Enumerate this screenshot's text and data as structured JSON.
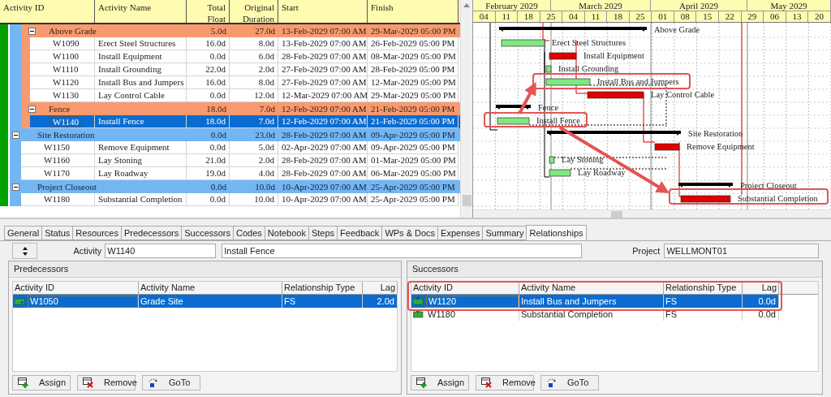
{
  "table": {
    "columns": [
      "Activity ID",
      "Activity Name",
      "Total Float",
      "Original Duration",
      "Start",
      "Finish"
    ],
    "rows": [
      {
        "kind": "subgroup",
        "name": "Above Grade",
        "expanded": true,
        "selected": false,
        "total_float": "5.0d",
        "original_duration": "27.0d",
        "start": "13-Feb-2029 07:00 AM",
        "finish": "29-Mar-2029 05:00 PM",
        "children": [
          {
            "id": "W1090",
            "name": "Erect Steel Structures",
            "selected": false,
            "total_float": "16.0d",
            "original_duration": "8.0d",
            "start": "13-Feb-2029 07:00 AM",
            "finish": "26-Feb-2029 05:00 PM"
          },
          {
            "id": "W1100",
            "name": "Install Equipment",
            "selected": false,
            "total_float": "0.0d",
            "original_duration": "6.0d",
            "start": "28-Feb-2029 07:00 AM",
            "finish": "08-Mar-2029 05:00 PM"
          },
          {
            "id": "W1110",
            "name": "Install Grounding",
            "selected": false,
            "total_float": "22.0d",
            "original_duration": "2.0d",
            "start": "27-Feb-2029 07:00 AM",
            "finish": "28-Feb-2029 05:00 PM"
          },
          {
            "id": "W1120",
            "name": "Install Bus and Jumpers",
            "selected": false,
            "total_float": "16.0d",
            "original_duration": "8.0d",
            "start": "27-Feb-2029 07:00 AM",
            "finish": "12-Mar-2029 05:00 PM"
          },
          {
            "id": "W1130",
            "name": "Lay Control Cable",
            "selected": false,
            "total_float": "0.0d",
            "original_duration": "12.0d",
            "start": "12-Mar-2029 07:00 AM",
            "finish": "29-Mar-2029 05:00 PM"
          }
        ]
      },
      {
        "kind": "subgroup",
        "name": "Fence",
        "expanded": true,
        "selected": false,
        "total_float": "18.0d",
        "original_duration": "7.0d",
        "start": "12-Feb-2029 07:00 AM",
        "finish": "21-Feb-2029 05:00 PM",
        "children": [
          {
            "id": "W1140",
            "name": "Install Fence",
            "selected": true,
            "total_float": "18.0d",
            "original_duration": "7.0d",
            "start": "12-Feb-2029 07:00 AM",
            "finish": "21-Feb-2029 05:00 PM"
          }
        ]
      },
      {
        "kind": "group",
        "name": "Site Restoration",
        "expanded": true,
        "selected": false,
        "total_float": "0.0d",
        "original_duration": "23.0d",
        "start": "28-Feb-2029 07:00 AM",
        "finish": "09-Apr-2029 05:00 PM",
        "children": [
          {
            "id": "W1150",
            "name": "Remove Equipment",
            "selected": false,
            "total_float": "0.0d",
            "original_duration": "5.0d",
            "start": "02-Apr-2029 07:00 AM",
            "finish": "09-Apr-2029 05:00 PM"
          },
          {
            "id": "W1160",
            "name": "Lay Stoning",
            "selected": false,
            "total_float": "21.0d",
            "original_duration": "2.0d",
            "start": "28-Feb-2029 07:00 AM",
            "finish": "01-Mar-2029 05:00 PM"
          },
          {
            "id": "W1170",
            "name": "Lay Roadway",
            "selected": false,
            "total_float": "19.0d",
            "original_duration": "4.0d",
            "start": "28-Feb-2029 07:00 AM",
            "finish": "06-Mar-2029 05:00 PM"
          }
        ]
      },
      {
        "kind": "group",
        "name": "Project Closeout",
        "expanded": true,
        "selected": false,
        "total_float": "0.0d",
        "original_duration": "10.0d",
        "start": "10-Apr-2029 07:00 AM",
        "finish": "25-Apr-2029 05:00 PM",
        "children": [
          {
            "id": "W1180",
            "name": "Substantial Completion",
            "selected": false,
            "total_float": "0.0d",
            "original_duration": "10.0d",
            "start": "10-Apr-2029 07:00 AM",
            "finish": "25-Apr-2029 05:00 PM"
          }
        ]
      }
    ]
  },
  "gantt": {
    "months": [
      "February 2029",
      "March 2029",
      "April 2029",
      "May 2029"
    ],
    "weeks": [
      "04",
      "11",
      "18",
      "25",
      "04",
      "11",
      "18",
      "25",
      "01",
      "08",
      "15",
      "22",
      "29",
      "06",
      "13",
      "20"
    ],
    "bars": [
      {
        "kind": "summary",
        "label": "Above Grade"
      },
      {
        "kind": "activity",
        "label": "Erect Steel Structures",
        "color": "#80e880"
      },
      {
        "kind": "activity",
        "label": "Install Equipment",
        "color": "#e00000"
      },
      {
        "kind": "activity",
        "label": "Install Grounding",
        "color": "#80e880"
      },
      {
        "kind": "activity",
        "label": "Install Bus and Jumpers",
        "color": "#80e880"
      },
      {
        "kind": "activity",
        "label": "Lay Control Cable",
        "color": "#e00000"
      },
      {
        "kind": "summary",
        "label": "Fence"
      },
      {
        "kind": "activity",
        "label": "Install Fence",
        "color": "#80e880"
      },
      {
        "kind": "summary",
        "label": "Site Restoration"
      },
      {
        "kind": "activity",
        "label": "Remove Equipment",
        "color": "#e00000"
      },
      {
        "kind": "activity",
        "label": "Lay Stoning",
        "color": "#80e880"
      },
      {
        "kind": "activity",
        "label": "Lay Roadway",
        "color": "#80e880"
      },
      {
        "kind": "summary",
        "label": "Project Closeout"
      },
      {
        "kind": "activity",
        "label": "Substantial Completion",
        "color": "#e00000"
      }
    ]
  },
  "detail_tabs": [
    {
      "label": "General",
      "selected": false
    },
    {
      "label": "Status",
      "selected": false
    },
    {
      "label": "Resources",
      "selected": false
    },
    {
      "label": "Predecessors",
      "selected": false
    },
    {
      "label": "Successors",
      "selected": false
    },
    {
      "label": "Codes",
      "selected": false
    },
    {
      "label": "Notebook",
      "selected": false
    },
    {
      "label": "Steps",
      "selected": false
    },
    {
      "label": "Feedback",
      "selected": false
    },
    {
      "label": "WPs & Docs",
      "selected": false
    },
    {
      "label": "Expenses",
      "selected": false
    },
    {
      "label": "Summary",
      "selected": false
    },
    {
      "label": "Relationships",
      "selected": true
    }
  ],
  "activity": {
    "label": "Activity",
    "id": "W1140",
    "name": "Install Fence"
  },
  "project": {
    "label": "Project",
    "value": "WELLMONT01"
  },
  "predecessors": {
    "title": "Predecessors",
    "columns": [
      "Activity ID",
      "Activity Name",
      "Relationship Type",
      "Lag"
    ],
    "rows": [
      {
        "id": "W1050",
        "name": "Grade Site",
        "type": "FS",
        "lag": "2.0d",
        "selected": true
      }
    ],
    "buttons": [
      "Assign",
      "Remove",
      "GoTo"
    ]
  },
  "successors": {
    "title": "Successors",
    "columns": [
      "Activity ID",
      "Activity Name",
      "Relationship Type",
      "Lag"
    ],
    "rows": [
      {
        "id": "W1120",
        "name": "Install Bus and Jumpers",
        "type": "FS",
        "lag": "0.0d",
        "selected": true
      },
      {
        "id": "W1180",
        "name": "Substantial Completion",
        "type": "FS",
        "lag": "0.0d",
        "selected": false
      }
    ],
    "buttons": [
      "Assign",
      "Remove",
      "GoTo"
    ]
  }
}
